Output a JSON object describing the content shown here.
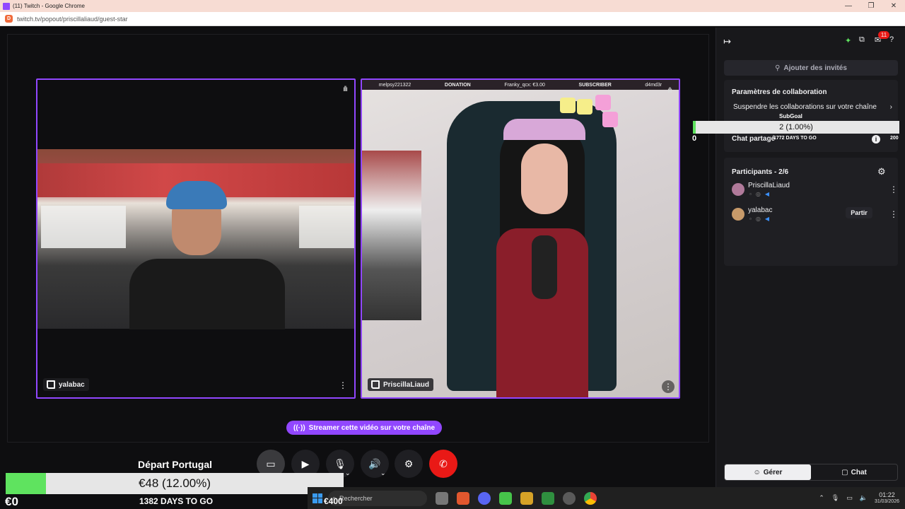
{
  "browser": {
    "window_title": "(11) Twitch - Google Chrome",
    "url": "twitch.tv/popout/priscillaliaud/guest-star"
  },
  "tiles": [
    {
      "name": "yalabac"
    },
    {
      "name": "PriscillaLiaud"
    }
  ],
  "stream_overlay": {
    "tickers": [
      "melpsy221322",
      "DONATION",
      "Franky_qcx: €3.00",
      "SUBSCRIBER",
      "d4md3r"
    ]
  },
  "stream_button": {
    "label": "Streamer cette vidéo sur votre chaîne"
  },
  "controls": [
    "screen-share",
    "camera",
    "microphone",
    "volume",
    "settings",
    "leave-call"
  ],
  "panel": {
    "add_guests": "Ajouter des invités",
    "collab_title": "Paramètres de collaboration",
    "suspend_collab": "Suspendre les collaborations sur votre chaîne",
    "shared_chat": "Chat partagé",
    "participants_title": "Participants - 2/6",
    "participants": [
      {
        "name": "PriscillaLiaud",
        "avatar_color": "#b07a9a",
        "action": ""
      },
      {
        "name": "yalabac",
        "avatar_color": "#c79a6a",
        "action": "Partir"
      }
    ],
    "tabs": {
      "manage": "Gérer",
      "chat": "Chat"
    },
    "notification_count": "11"
  },
  "subgoal": {
    "title": "SubGoal",
    "value": "2 (1.00%)",
    "progress": 0.01,
    "start": "0",
    "end": "200",
    "days": "1772 DAYS TO GO"
  },
  "donation_goal": {
    "title": "Départ Portugal",
    "value": "€48 (12.00%)",
    "progress": 0.12,
    "start": "€0",
    "end": "€400",
    "days": "1382 DAYS TO GO"
  },
  "taskbar": {
    "search_placeholder": "Rechercher",
    "time": "01:22",
    "date": "31/03/2026"
  },
  "colors": {
    "accent": "#9147ff",
    "hangup": "#e91916",
    "goal_fill": "#5fe35f"
  }
}
